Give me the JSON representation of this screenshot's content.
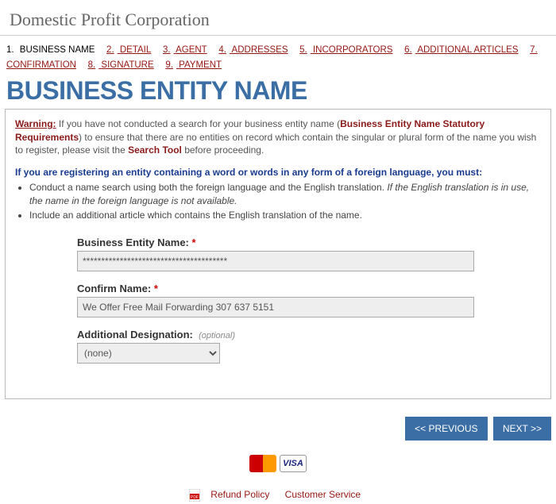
{
  "page_title": "Domestic Profit Corporation",
  "steps": [
    {
      "n": "1.",
      "label": "BUSINESS NAME",
      "current": true
    },
    {
      "n": "2.",
      "label": "DETAIL"
    },
    {
      "n": "3.",
      "label": "AGENT"
    },
    {
      "n": "4.",
      "label": "ADDRESSES"
    },
    {
      "n": "5.",
      "label": "INCORPORATORS"
    },
    {
      "n": "6.",
      "label": "ADDITIONAL ARTICLES"
    },
    {
      "n": "7.",
      "label": "CONFIRMATION"
    },
    {
      "n": "8.",
      "label": "SIGNATURE"
    },
    {
      "n": "9.",
      "label": "PAYMENT"
    }
  ],
  "heading": "BUSINESS ENTITY NAME",
  "warning": {
    "label": "Warning:",
    "pre": " If you have not conducted a search for your business entity name (",
    "req_link": "Business Entity Name Statutory Requirements",
    "mid": ") to ensure that there are no entities on record which contain the singular or plural form of the name you wish to register, please visit the ",
    "search_link": "Search Tool",
    "post": " before proceeding."
  },
  "foreign_heading": "If you are registering an entity containing a word or words in any form of a foreign language, you must:",
  "bullets": {
    "b1_pre": "Conduct a name search using both the foreign language and the English translation. ",
    "b1_em": "If the English translation is in use, the name in the foreign language is not available.",
    "b2": "Include an additional article which contains the English translation of the name."
  },
  "fields": {
    "name_label": "Business Entity Name:",
    "name_value": "***************************************",
    "confirm_label": "Confirm Name:",
    "confirm_value": "We Offer Free Mail Forwarding 307 637 5151",
    "designation_label": "Additional Designation:",
    "designation_optional": "(optional)",
    "designation_value": "(none)"
  },
  "buttons": {
    "prev": "<< PREVIOUS",
    "next": "NEXT >>"
  },
  "footer": {
    "refund": "Refund Policy",
    "service": "Customer Service"
  }
}
